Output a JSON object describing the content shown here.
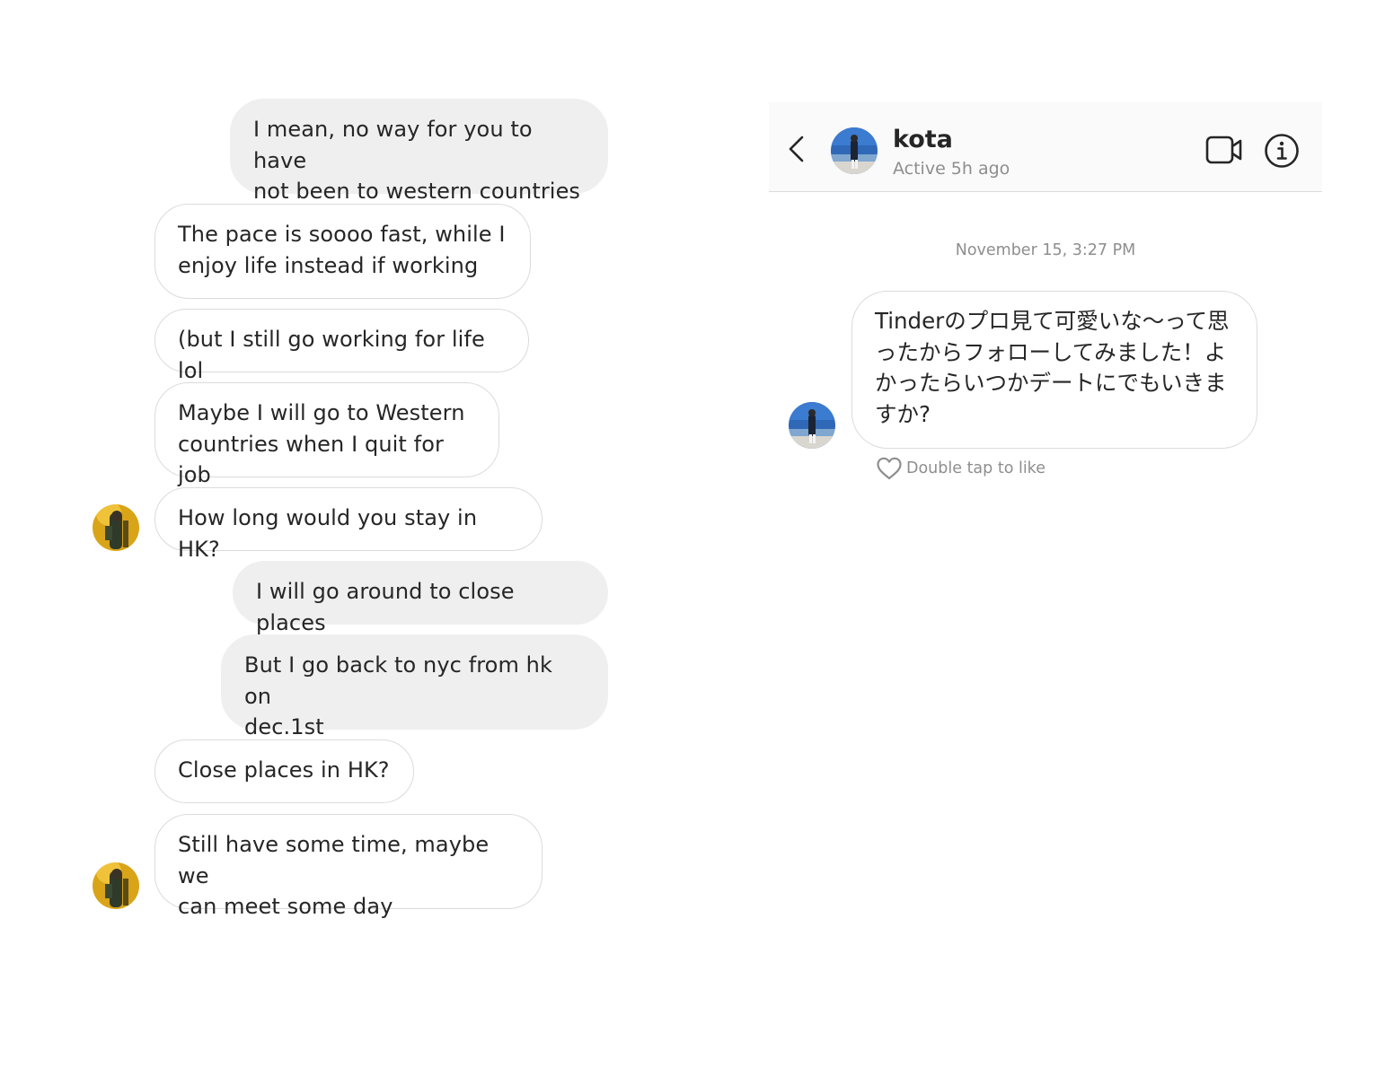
{
  "left_chat": {
    "messages": [
      {
        "id": "m1",
        "side": "out",
        "text": "I mean, no way for you to have\nnot been to western countries"
      },
      {
        "id": "m2",
        "side": "in",
        "text": "The pace is soooo fast, while I\nenjoy life instead if working"
      },
      {
        "id": "m3",
        "side": "in",
        "text": "(but I still go working for life lol"
      },
      {
        "id": "m4",
        "side": "in",
        "text": "Maybe I will go to Western\ncountries when I quit for job"
      },
      {
        "id": "m5",
        "side": "in",
        "text": "How long would you stay in HK?"
      },
      {
        "id": "m6",
        "side": "out",
        "text": "I will go around to close places"
      },
      {
        "id": "m7",
        "side": "out",
        "text": "But I go back to nyc from hk on\ndec.1st"
      },
      {
        "id": "m8",
        "side": "in",
        "text": "Close places in HK?"
      },
      {
        "id": "m9",
        "side": "in",
        "text": "Still have some time, maybe we\ncan meet some day"
      }
    ]
  },
  "right_chat": {
    "header": {
      "name": "kota",
      "status": "Active 5h ago",
      "icons": [
        "chevron-left-icon",
        "video-call-icon",
        "info-icon"
      ]
    },
    "timestamp": "November 15, 3:27 PM",
    "message": {
      "text": "Tinderのプロ見て可愛いな～って思ったからフォローしてみました！よかったらいつかデートにでもいきますか?"
    },
    "like_hint": "Double tap to like"
  },
  "colors": {
    "incoming_bubble_border": "#dbdbdb",
    "outgoing_bubble_bg": "#efefef",
    "secondary_text": "#8e8e8e",
    "primary_text": "#262626",
    "header_bg": "#fafafa"
  }
}
